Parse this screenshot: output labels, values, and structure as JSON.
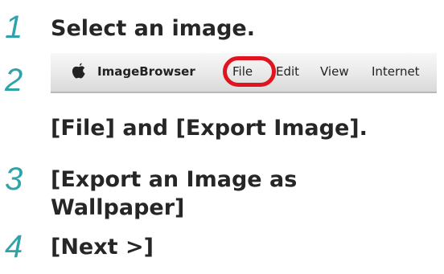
{
  "steps": [
    {
      "number": "1",
      "text": "Select an image."
    },
    {
      "number": "2",
      "text": "[File] and [Export Image]."
    },
    {
      "number": "3",
      "text_line1": "[Export an Image as",
      "text_line2": "Wallpaper]"
    },
    {
      "number": "4",
      "text": "[Next >]"
    }
  ],
  "menubar": {
    "apple_icon": "apple-logo-icon",
    "app_name": "ImageBrowser",
    "items": [
      "File",
      "Edit",
      "View",
      "Internet"
    ],
    "highlighted_item": "File"
  },
  "colors": {
    "step_number": "#2fa3a8",
    "highlight_ring": "#e0141e",
    "text": "#262626"
  }
}
